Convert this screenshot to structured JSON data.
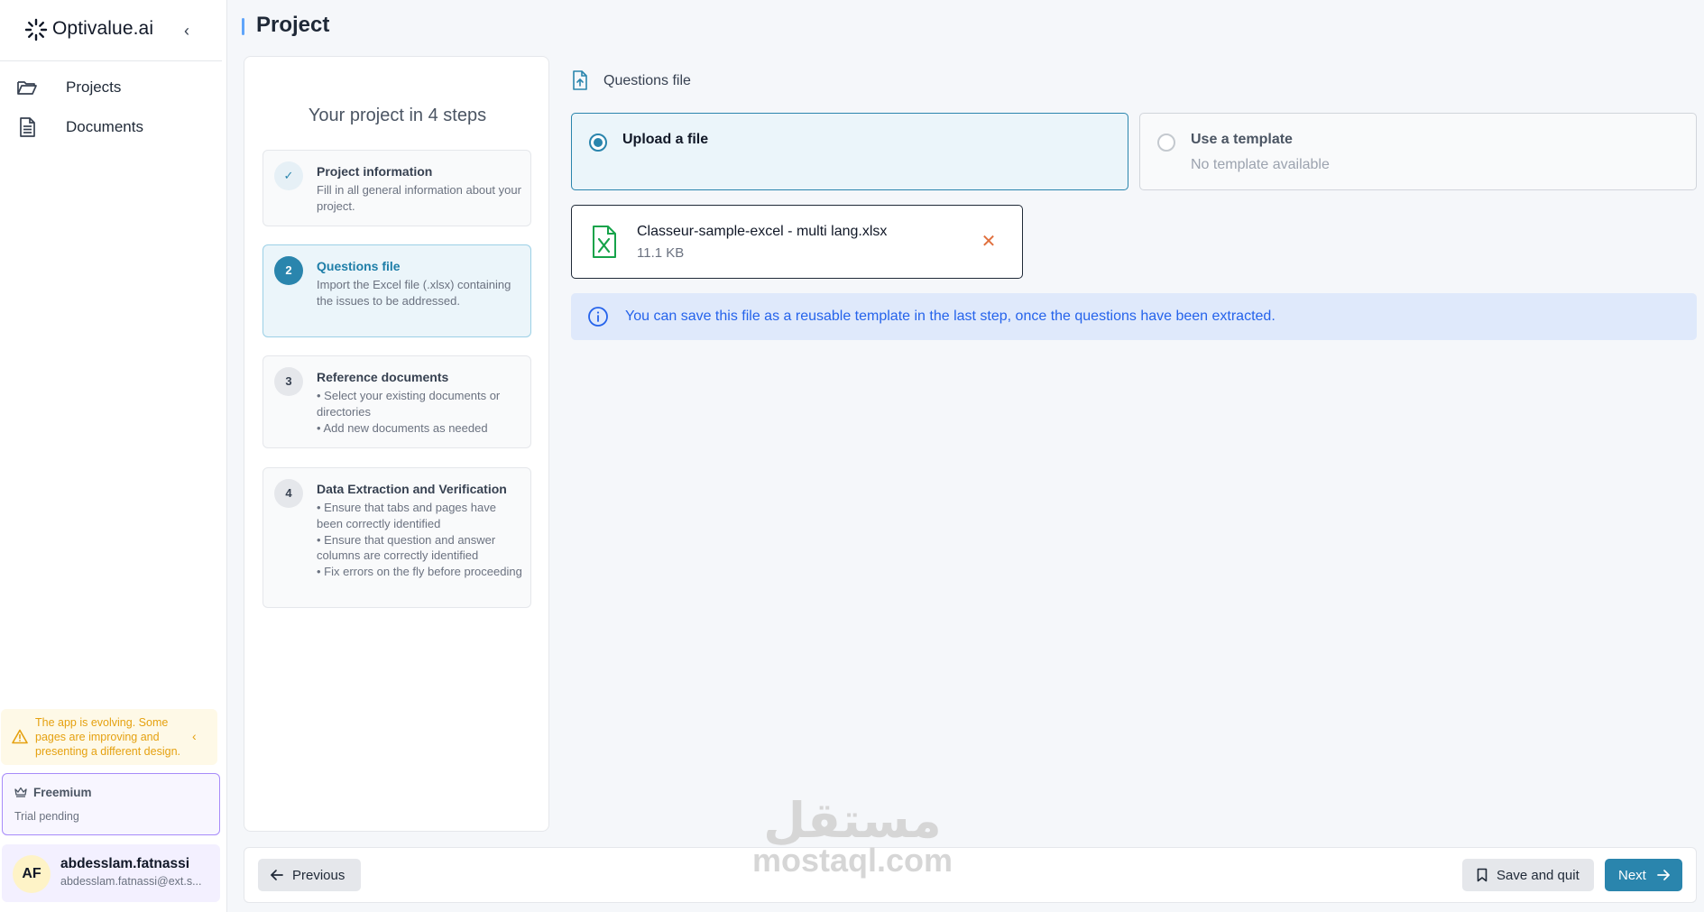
{
  "app": {
    "brand_name": "Optivalue.ai",
    "collapse_icon": "chevron-left-icon"
  },
  "sidebar": {
    "items": [
      {
        "label": "Projects",
        "icon": "folder-open-icon"
      },
      {
        "label": "Documents",
        "icon": "document-icon"
      }
    ],
    "notice": {
      "text": "The app is evolving. Some pages are improving and presenting a different design.",
      "color": "#e5a110"
    },
    "plan": {
      "name": "Freemium",
      "status": "Trial pending"
    },
    "user": {
      "initials": "AF",
      "name": "abdesslam.fatnassi",
      "email": "abdesslam.fatnassi@ext.s..."
    }
  },
  "header": {
    "title": "Project"
  },
  "steps_panel": {
    "title": "Your project in 4 steps",
    "steps": [
      {
        "badge": "✓",
        "name": "Project information",
        "description": "Fill in all general information about your project.",
        "state": "done"
      },
      {
        "badge": "2",
        "name": "Questions file",
        "description": "Import the Excel file (.xlsx) containing the issues to be addressed.",
        "state": "active"
      },
      {
        "badge": "3",
        "name": "Reference documents",
        "description": "• Select your existing documents or directories\n• Add new documents as needed",
        "state": "pending"
      },
      {
        "badge": "4",
        "name": "Data Extraction and Verification",
        "description": "• Ensure that tabs and pages have been correctly identified\n• Ensure that question and answer columns are correctly identified\n• Fix errors on the fly before proceeding",
        "state": "pending"
      }
    ]
  },
  "main": {
    "section_label": "Questions file",
    "options": {
      "upload": {
        "label": "Upload a file",
        "selected": true
      },
      "template": {
        "label": "Use a template",
        "sublabel": "No template available",
        "selected": false
      }
    },
    "file": {
      "name": "Classeur-sample-excel - multi lang.xlsx",
      "size": "11.1 KB",
      "icon": "excel-file-icon"
    },
    "info_text": "You can save this file as a reusable template in the last step, once the questions have been extracted."
  },
  "footer": {
    "previous_label": "Previous",
    "save_label": "Save and quit",
    "next_label": "Next"
  },
  "watermark": {
    "arabic": "مستقل",
    "latin": "mostaql.com"
  },
  "colors": {
    "primary": "#2a85ad",
    "info_bg": "#dfe9fb",
    "info_text": "#2563eb",
    "accent_purple": "#a78bfa"
  }
}
